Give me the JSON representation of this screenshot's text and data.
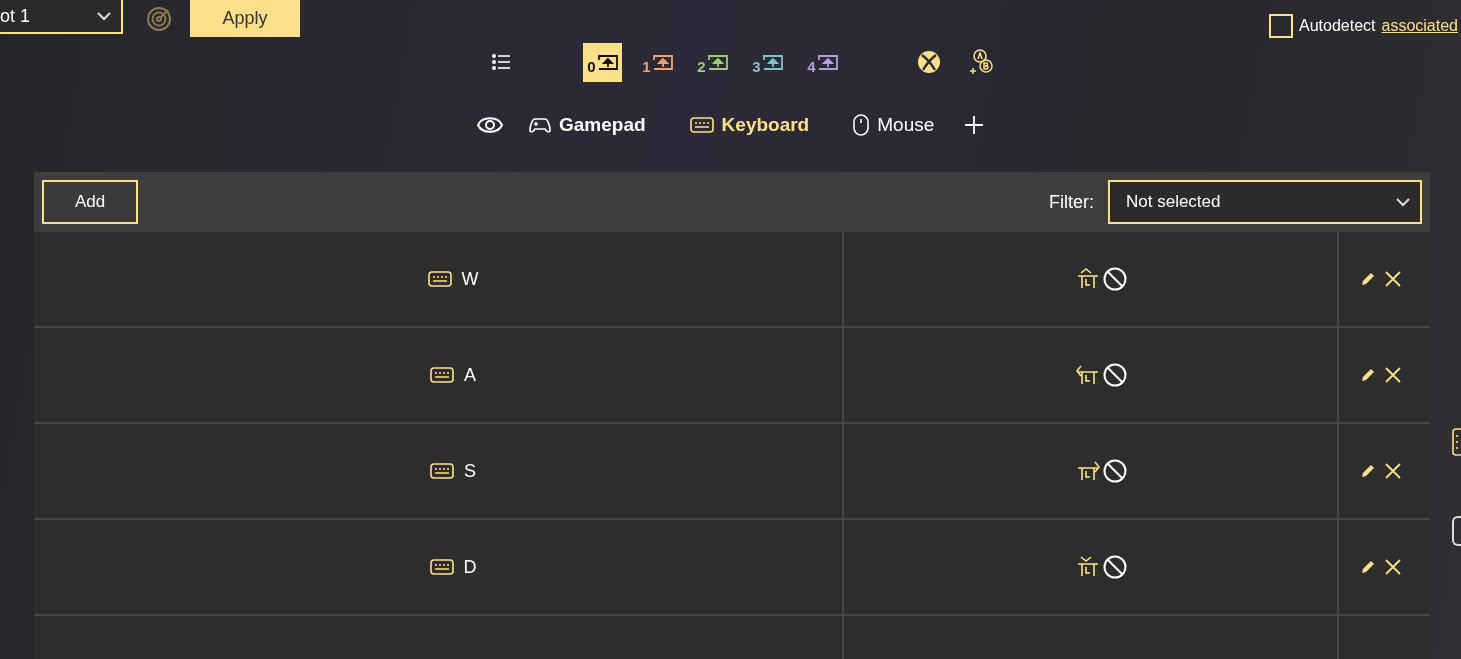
{
  "top_bar": {
    "profile_dropdown": {
      "value": "ot 1"
    },
    "apply_button": "Apply",
    "autodetect": {
      "checked": false,
      "label": "Autodetect",
      "link": "associated"
    }
  },
  "slots": [
    {
      "label": "0",
      "color": "#ffe08a",
      "selected": true
    },
    {
      "label": "1",
      "color": "#f0a070",
      "selected": false
    },
    {
      "label": "2",
      "color": "#9ccc70",
      "selected": false
    },
    {
      "label": "3",
      "color": "#7cc4cc",
      "selected": false
    },
    {
      "label": "4",
      "color": "#b89ce0",
      "selected": false
    }
  ],
  "device_tabs": [
    {
      "label": "Gamepad",
      "kind": "gamepad",
      "selected": false
    },
    {
      "label": "Keyboard",
      "kind": "keyboard",
      "selected": true
    },
    {
      "label": "Mouse",
      "kind": "mouse",
      "selected": false
    }
  ],
  "toolbar": {
    "add_button": "Add",
    "filter_label": "Filter:",
    "filter_value": "Not selected"
  },
  "rows": [
    {
      "key": "W",
      "kind": "up"
    },
    {
      "key": "A",
      "kind": "left"
    },
    {
      "key": "S",
      "kind": "right"
    },
    {
      "key": "D",
      "kind": "down"
    }
  ]
}
